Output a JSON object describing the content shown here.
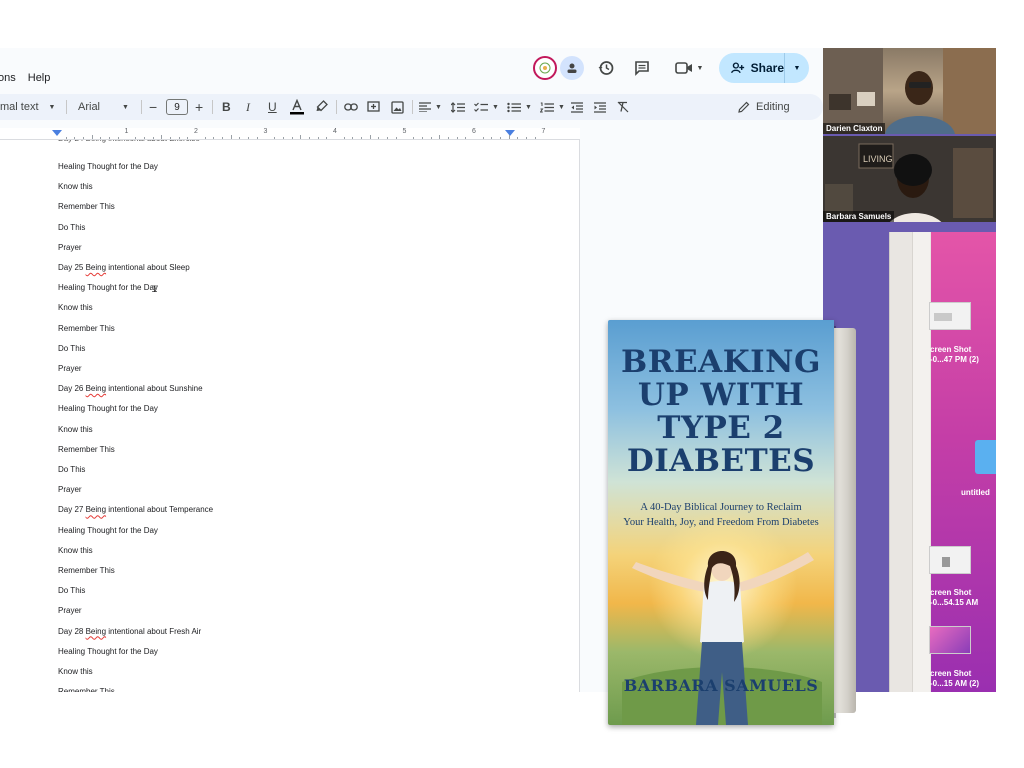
{
  "menu": {
    "items": [
      "ons",
      "Help"
    ]
  },
  "toolbar": {
    "style": "mal text",
    "font": "Arial",
    "font_size": "9",
    "mode": "Editing",
    "share": "Share"
  },
  "ruler": {
    "numbers": [
      "1",
      "2",
      "3",
      "4",
      "5",
      "6",
      "7"
    ]
  },
  "document": {
    "lines": [
      {
        "text": "Healing Thought for the Day"
      },
      {
        "text": "Know this"
      },
      {
        "text": "Remember This"
      },
      {
        "text": "Do This"
      },
      {
        "text": "Prayer"
      },
      {
        "pre": "Day 25 ",
        "sq": "Being",
        "post": " intentional about Sleep"
      },
      {
        "text": "Healing Thought for the Day"
      },
      {
        "text": "Know this"
      },
      {
        "text": "Remember This"
      },
      {
        "text": "Do This"
      },
      {
        "text": "Prayer"
      },
      {
        "pre": "Day 26 ",
        "sq": "Being",
        "post": " intentional about Sunshine"
      },
      {
        "text": "Healing Thought for the Day"
      },
      {
        "text": "Know this"
      },
      {
        "text": "Remember This"
      },
      {
        "text": "Do This"
      },
      {
        "text": "Prayer"
      },
      {
        "pre": "Day 27 ",
        "sq": "Being",
        "post": " intentional about  Temperance"
      },
      {
        "text": "Healing Thought for the Day"
      },
      {
        "text": "Know this"
      },
      {
        "text": "Remember This"
      },
      {
        "text": "Do This"
      },
      {
        "text": "Prayer"
      },
      {
        "pre": "Day 28 ",
        "sq": "Being",
        "post": " intentional about Fresh Air"
      },
      {
        "text": "Healing Thought for the Day"
      },
      {
        "text": "Know this"
      },
      {
        "text": "Remember This"
      }
    ]
  },
  "participants": [
    {
      "name": "Darien Claxton"
    },
    {
      "name": "Barbara Samuels"
    }
  ],
  "desktop": {
    "items": [
      {
        "line1": "creen Shot",
        "line2": "-0...47 PM (2)"
      },
      {
        "line1": "creen Shot",
        "line2": "-0...54.15 AM"
      },
      {
        "line1": "creen Shot",
        "line2": "-0...15 AM (2)"
      }
    ],
    "folder": "untitled"
  },
  "book": {
    "title_lines": [
      "BREAKING",
      "UP WITH",
      "TYPE 2",
      "DIABETES"
    ],
    "subtitle_lines": [
      "A 40-Day Biblical Journey to Reclaim",
      "Your Health, Joy, and Freedom From Diabetes"
    ],
    "author": "BARBARA SAMUELS"
  },
  "colors": {
    "accent": "#c2e7ff",
    "toolbar_bg": "#edf2fa",
    "title_blue": "#1b3f6e"
  }
}
